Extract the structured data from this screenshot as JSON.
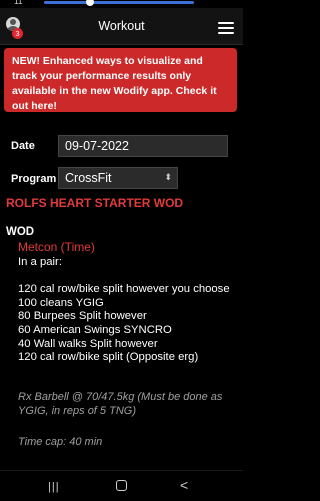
{
  "status": {
    "time": "11"
  },
  "header": {
    "title": "Workout",
    "notification_count": "3"
  },
  "banner": {
    "text": "NEW! Enhanced ways to visualize and track your performance results only available in the new Wodify app. Check it out here!"
  },
  "form": {
    "date_label": "Date",
    "date_value": "09-07-2022",
    "program_label": "Program",
    "program_value": "CrossFit"
  },
  "wod": {
    "name": "ROLFS HEART STARTER WOD",
    "heading": "WOD",
    "section_title": "Metcon (Time)",
    "description": "In a pair:\n\n120 cal row/bike split however you choose\n100 cleans YGIG\n80 Burpees Split however\n60 American Swings SYNCRO\n40 Wall walks Split however\n120 cal row/bike split (Opposite erg)",
    "rx_note": "Rx Barbell @ 70/47.5kg (Must be done as YGIG, in reps of 5 TNG)",
    "time_cap": "Time cap: 40 min"
  },
  "navbar": {
    "recent": "|||",
    "home": "",
    "back": "<"
  }
}
